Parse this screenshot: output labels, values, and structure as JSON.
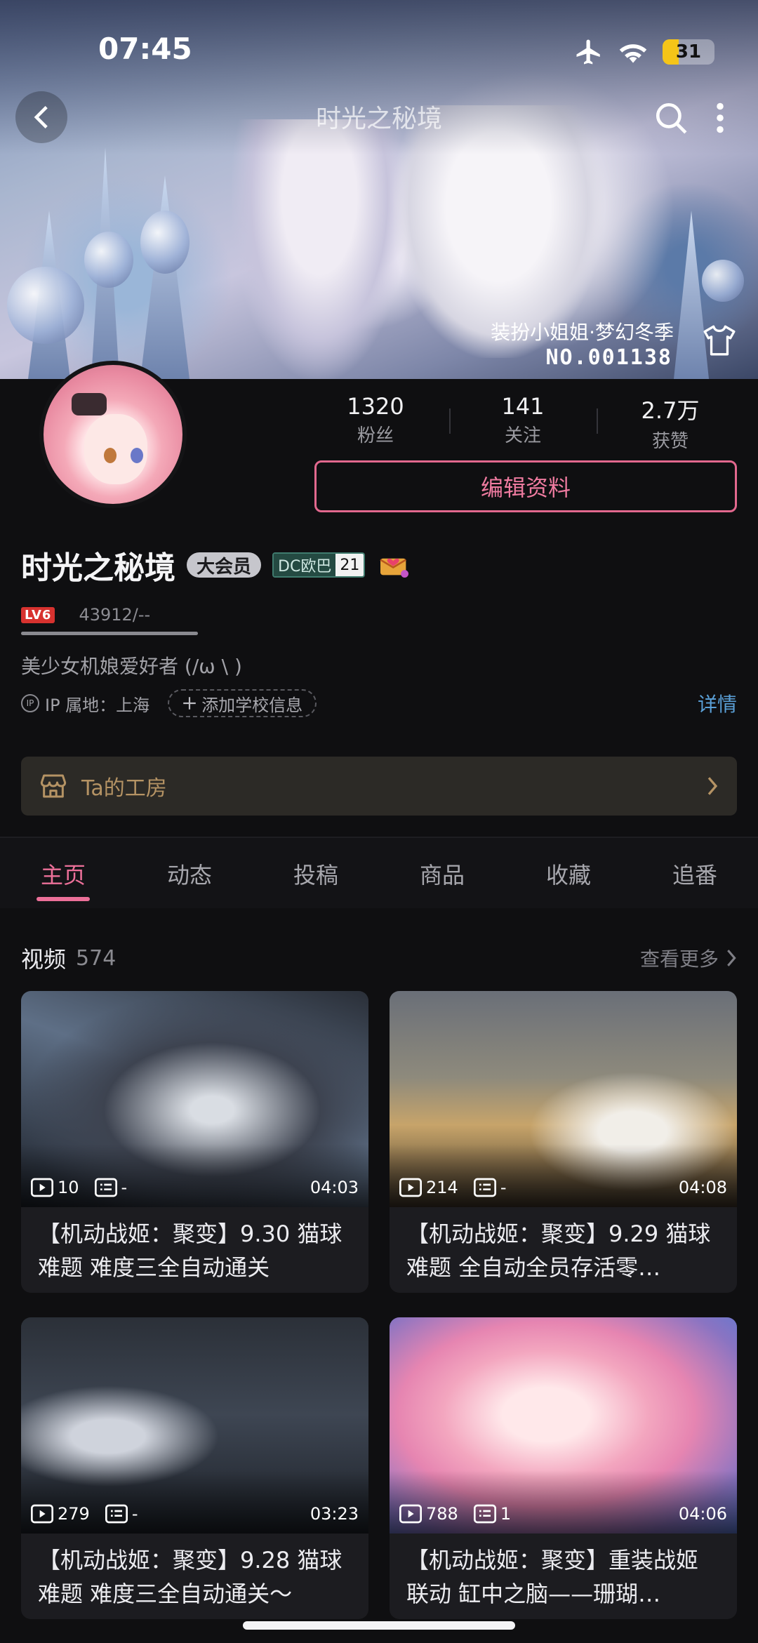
{
  "status_bar": {
    "time": "07:45",
    "battery": "31",
    "battery_level": 0.31
  },
  "nav": {
    "title": "时光之秘境"
  },
  "banner": {
    "suit_name": "装扮小姐姐·梦幻冬季",
    "suit_no": "NO.001138"
  },
  "profile": {
    "stats": [
      {
        "value": "1320",
        "label": "粉丝"
      },
      {
        "value": "141",
        "label": "关注"
      },
      {
        "value": "2.7万",
        "label": "获赞"
      }
    ],
    "edit_label": "编辑资料",
    "username": "时光之秘境",
    "vip_label": "大会员",
    "badge_name": "DC欧巴",
    "badge_level": "21",
    "level": "LV6",
    "exp": "43912/--",
    "bio": "美少女机娘爱好者 (/ω \\ )",
    "ip": "IP 属地：上海",
    "school": "添加学校信息",
    "detail": "详情",
    "workshop": "Ta的工房"
  },
  "tabs": [
    "主页",
    "动态",
    "投稿",
    "商品",
    "收藏",
    "追番"
  ],
  "videos": {
    "title": "视频",
    "count": "574",
    "see_more": "查看更多",
    "items": [
      {
        "plays": "10",
        "comments": "-",
        "duration": "04:03",
        "title": "【机动战姬：聚变】9.30 猫球难题 难度三全自动通关"
      },
      {
        "plays": "214",
        "comments": "-",
        "duration": "04:08",
        "title": "【机动战姬：聚变】9.29 猫球难题 全自动全员存活零…"
      },
      {
        "plays": "279",
        "comments": "-",
        "duration": "03:23",
        "title": "【机动战姬：聚变】9.28 猫球难题 难度三全自动通关～"
      },
      {
        "plays": "788",
        "comments": "1",
        "duration": "04:06",
        "title": "【机动战姬：聚变】重装战姬联动 缸中之脑——珊瑚…"
      }
    ]
  }
}
